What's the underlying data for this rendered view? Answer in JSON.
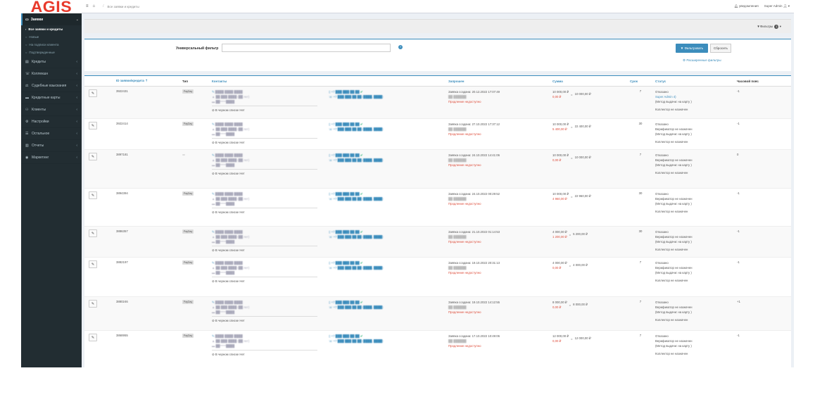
{
  "app": {
    "logo": "AGIS"
  },
  "sidebar": {
    "section": "Заявки",
    "subitems": [
      {
        "label": "Все заявки и кредиты",
        "active": true
      },
      {
        "label": "Новые",
        "active": false
      },
      {
        "label": "На подписи клиента",
        "active": false
      },
      {
        "label": "Подтвержденные",
        "active": false
      }
    ],
    "items": [
      {
        "label": "Кредиты",
        "icon": "credit-icon"
      },
      {
        "label": "Коллекшн",
        "icon": "phone-icon"
      },
      {
        "label": "Судебные взыскания",
        "icon": "gavel-icon"
      },
      {
        "label": "Кредитные карты",
        "icon": "card-icon"
      },
      {
        "label": "Клиенты",
        "icon": "users-icon"
      },
      {
        "label": "Настройки",
        "icon": "gear-icon"
      },
      {
        "label": "Остальное",
        "icon": "list-icon"
      },
      {
        "label": "Отчеты",
        "icon": "report-icon"
      },
      {
        "label": "Маркетинг",
        "icon": "target-icon"
      }
    ]
  },
  "topbar": {
    "crumb": "Все заявки и кредиты",
    "notifications": "уведомления",
    "user": "Super Admin"
  },
  "filters": {
    "toggle": "Фильтры",
    "count": "1",
    "universal_label": "Универсальный фильтр",
    "universal_placeholder": "",
    "apply": "Фильтровать",
    "reset": "Сбросить",
    "advanced": "Расширенные фильтры"
  },
  "table": {
    "columns": [
      "ID заявки/кредита",
      "Тип",
      "Контакты",
      "",
      "Запрошен",
      "Сумма",
      "Срок",
      "Статус",
      "Часовой пояс"
    ],
    "rows": [
      {
        "id": "3922431",
        "type": "PayDay",
        "created": "Заявка создана: 20.12.2022 17:07:49",
        "result": "Продление недоступно",
        "sum1": "10 000,00 ₽",
        "sum2": "0,00 ₽",
        "total": "10 000,00 ₽",
        "term": "7",
        "status": "Отказано",
        "status_by": "Super Admin 4)",
        "status_note": "(Метод выдачи: на карту )",
        "collector": "Коллектор не назначен",
        "tz": "-1",
        "no_consent": "В черном списке Нет"
      },
      {
        "id": "3922414",
        "type": "PayDay",
        "created": "Заявка создана: 27.10.2022 17:37:12",
        "result": "Продление недоступно",
        "sum1": "10 000,00 ₽",
        "sum2": "5 400,00 ₽",
        "total": "22 400,00 ₽",
        "term": "30",
        "status": "Отказано",
        "status_by": "Верификатор не назначен",
        "status_note": "(Метод выдачи: на карту )",
        "collector": "Коллектор не назначен",
        "tz": "-1",
        "no_consent": "В черном списке Нет"
      },
      {
        "id": "3897181",
        "type": "",
        "created": "Заявка создана: 24.10.2022 14:41:06",
        "result": "Продление недоступно",
        "sum1": "10 000,00 ₽",
        "sum2": "0,00 ₽",
        "total": "10 000,00 ₽",
        "term": "7",
        "status": "Отказано",
        "status_by": "Верификатор не назначен",
        "status_note": "(Метод выдачи: на карту )",
        "collector": "Коллектор не назначен",
        "tz": "0",
        "no_consent": "В черном списке Нет"
      },
      {
        "id": "3894394",
        "type": "PayDay",
        "created": "Заявка создана: 24.10.2022 00:29:52",
        "result": "Продление недоступно",
        "sum1": "10 000,00 ₽",
        "sum2": "4 960,00 ₽",
        "total": "22 960,00 ₽",
        "term": "30",
        "status": "Отказано",
        "status_by": "Верификатор не назначен",
        "status_note": "(Метод выдачи: на карту )",
        "collector": "Коллектор не назначен",
        "tz": "-1",
        "no_consent": "В черном списке Нет"
      },
      {
        "id": "3886357",
        "type": "PayDay",
        "created": "Заявка создана: 21.10.2022 01:14:53",
        "result": "Продление недоступно",
        "sum1": "4 000,00 ₽",
        "sum2": "1 200,00 ₽",
        "total": "5 200,00 ₽",
        "term": "30",
        "status": "Отказано",
        "status_by": "Верификатор не назначен",
        "status_note": "(Метод выдачи: на карту )",
        "collector": "Коллектор не назначен",
        "tz": "-1",
        "no_consent": "В черном списке Нет"
      },
      {
        "id": "3882197",
        "type": "PayDay",
        "created": "Заявка создана: 19.10.2022 20:31:13",
        "result": "Продление недоступно",
        "sum1": "4 000,00 ₽",
        "sum2": "0,00 ₽",
        "total": "4 000,00 ₽",
        "term": "7",
        "status": "Отказано",
        "status_by": "Верификатор не назначен",
        "status_note": "(Метод выдачи: на карту )",
        "collector": "Коллектор не назначен",
        "tz": "-1",
        "no_consent": "В черном списке Нет"
      },
      {
        "id": "3880246",
        "type": "PayDay",
        "created": "Заявка создана: 19.10.2022 14:12:55",
        "result": "Продление недоступно",
        "sum1": "8 000,00 ₽",
        "sum2": "0,00 ₽",
        "total": "8 000,00 ₽",
        "term": "7",
        "status": "Отказано",
        "status_by": "Верификатор не назначен",
        "status_note": "(Метод выдачи: на карту )",
        "collector": "Коллектор не назначен",
        "tz": "+1",
        "no_consent": "В черном списке Нет"
      },
      {
        "id": "3868955",
        "type": "PayDay",
        "created": "Заявка создана: 17.10.2022 10:49:06",
        "result": "Продление недоступно",
        "sum1": "12 000,00 ₽",
        "sum2": "0,00 ₽",
        "total": "12 000,00 ₽",
        "term": "7",
        "status": "Отказано",
        "status_by": "Верификатор не назначен",
        "status_note": "(Метод выдачи: на карту )",
        "collector": "Коллектор не назначен",
        "tz": "-1",
        "no_consent": "В черном списке Нет"
      }
    ]
  }
}
